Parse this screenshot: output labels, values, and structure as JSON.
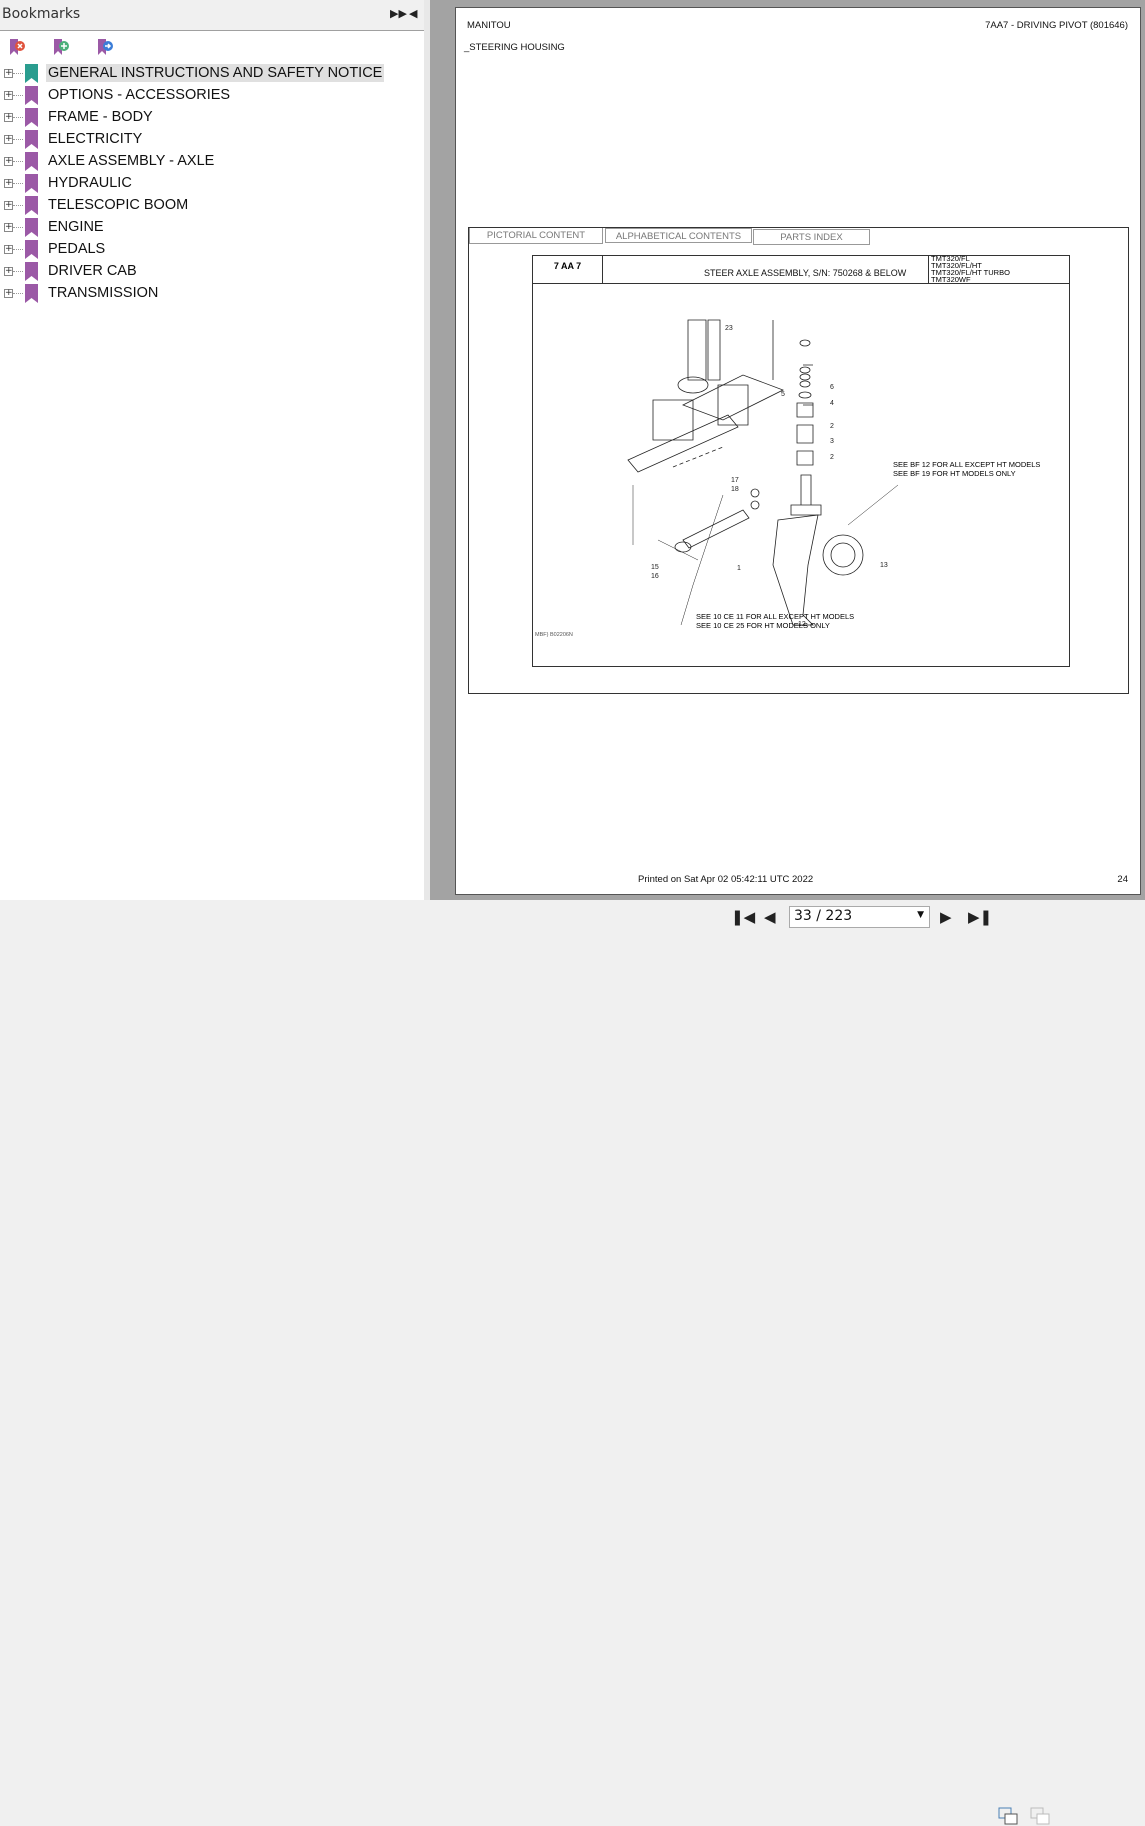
{
  "sidebar": {
    "title": "Bookmarks",
    "items": [
      {
        "label": "GENERAL INSTRUCTIONS AND SAFETY NOTICE"
      },
      {
        "label": "OPTIONS - ACCESSORIES"
      },
      {
        "label": "FRAME - BODY"
      },
      {
        "label": "ELECTRICITY"
      },
      {
        "label": "AXLE ASSEMBLY - AXLE"
      },
      {
        "label": "HYDRAULIC"
      },
      {
        "label": "TELESCOPIC BOOM"
      },
      {
        "label": "ENGINE"
      },
      {
        "label": "PEDALS"
      },
      {
        "label": "DRIVER CAB"
      },
      {
        "label": "TRANSMISSION"
      }
    ]
  },
  "page": {
    "brand": "MANITOU",
    "section": "7AA7 - DRIVING PIVOT (801646)",
    "subtitle": "_STEERING HOUSING",
    "tabs": [
      "PICTORIAL CONTENT",
      "ALPHABETICAL CONTENTS",
      "PARTS INDEX"
    ],
    "code": "7 AA 7",
    "assembly": "STEER AXLE ASSEMBLY, S/N: 750268 & BELOW",
    "models": [
      "TMT320/FL",
      "TMT320/FL/HT",
      "TMT320/FL/HT TURBO",
      "TMT320WF"
    ],
    "note1a": "SEE BF 12 FOR ALL EXCEPT HT MODELS",
    "note1b": "SEE BF 19 FOR HT MODELS ONLY",
    "note2a": "SEE 10 CE 11 FOR ALL EXCEPT HT MODELS",
    "note2b": "SEE 10 CE 25 FOR HT MODELS ONLY",
    "drawing_ref": "MBF) B02206N",
    "part_labels": [
      "23",
      "6",
      "5",
      "4",
      "2",
      "3",
      "2",
      "17",
      "18",
      "1",
      "15",
      "16",
      "12",
      "13"
    ],
    "printed": "Printed on  Sat Apr 02 05:42:11 UTC 2022",
    "page_number": "24"
  },
  "nav": {
    "page_field": "33 / 223"
  },
  "colors": {
    "selected_bookmark": "#2a9d8f",
    "bookmark": "#9b59a6"
  }
}
